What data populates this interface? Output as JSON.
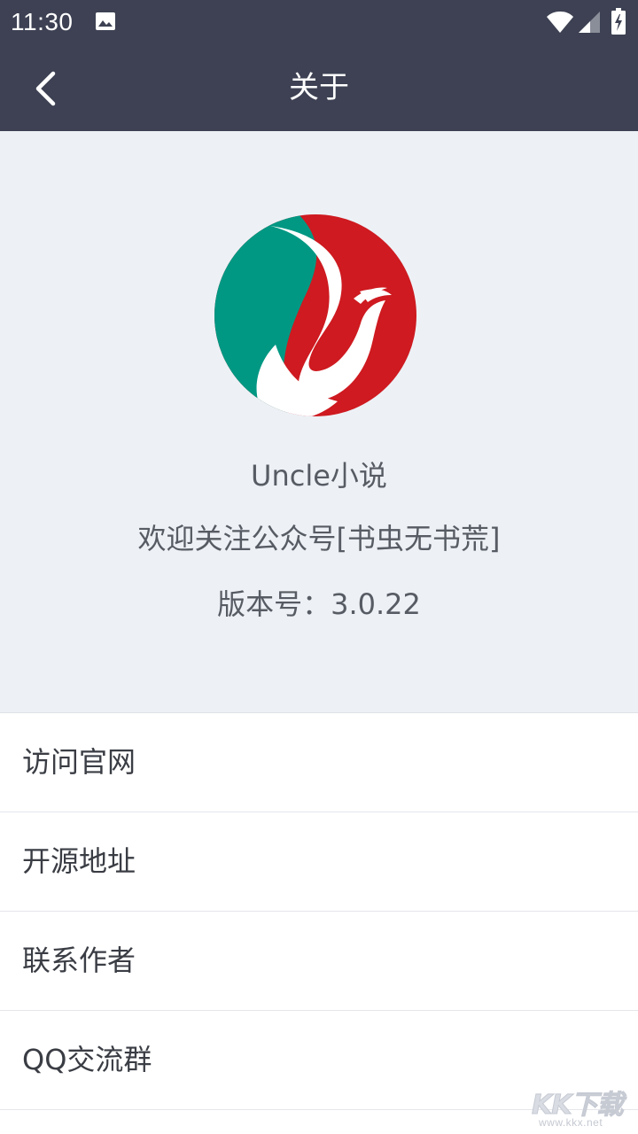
{
  "status_bar": {
    "time": "11:30",
    "icons": [
      "image-icon",
      "wifi-icon",
      "signal-icon",
      "battery-charging-icon"
    ]
  },
  "toolbar": {
    "title": "关于",
    "back_icon": "chevron-left-icon"
  },
  "about": {
    "logo_icon": "phoenix-logo",
    "app_name": "Uncle小说",
    "slogan": "欢迎关注公众号[书虫无书荒]",
    "version": "版本号：3.0.22"
  },
  "menu": {
    "items": [
      {
        "label": "访问官网"
      },
      {
        "label": "开源地址"
      },
      {
        "label": "联系作者"
      },
      {
        "label": "QQ交流群"
      }
    ]
  },
  "watermark": {
    "logo_text": "KK下载",
    "url": "www.kkx.net"
  },
  "colors": {
    "toolbar_bg": "#3d4153",
    "header_bg": "#edf1f6",
    "logo_green": "#009883",
    "logo_red": "#ce1a20",
    "text_secondary": "#575b63"
  }
}
